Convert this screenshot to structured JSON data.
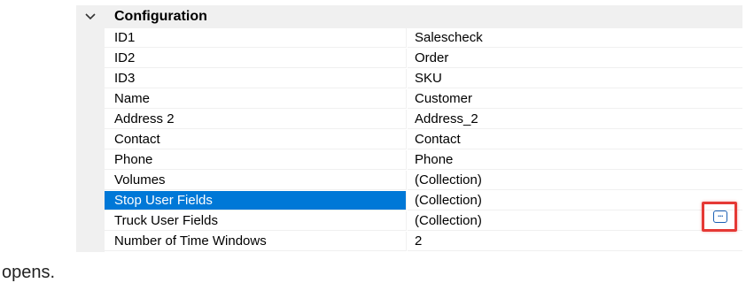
{
  "caption": "opens.",
  "category": {
    "title": "Configuration",
    "toggle_icon": "chevron-down-icon"
  },
  "properties": [
    {
      "name": "ID1",
      "value": "Salescheck",
      "selected": false
    },
    {
      "name": "ID2",
      "value": "Order",
      "selected": false
    },
    {
      "name": "ID3",
      "value": "SKU",
      "selected": false
    },
    {
      "name": "Name",
      "value": "Customer",
      "selected": false
    },
    {
      "name": "Address 2",
      "value": "Address_2",
      "selected": false
    },
    {
      "name": "Contact",
      "value": "Contact",
      "selected": false
    },
    {
      "name": "Phone",
      "value": "Phone",
      "selected": false
    },
    {
      "name": "Volumes",
      "value": "(Collection)",
      "selected": false
    },
    {
      "name": "Stop User Fields",
      "value": "(Collection)",
      "selected": true
    },
    {
      "name": "Truck User Fields",
      "value": "(Collection)",
      "selected": false
    },
    {
      "name": "Number of Time Windows",
      "value": "2",
      "selected": false
    }
  ],
  "ellipsis_button": {
    "label": "...",
    "icon": "ellipsis-icon"
  },
  "colors": {
    "selection": "#0078d7",
    "highlight_box": "#e53935",
    "margin": "#f0f0f0"
  }
}
